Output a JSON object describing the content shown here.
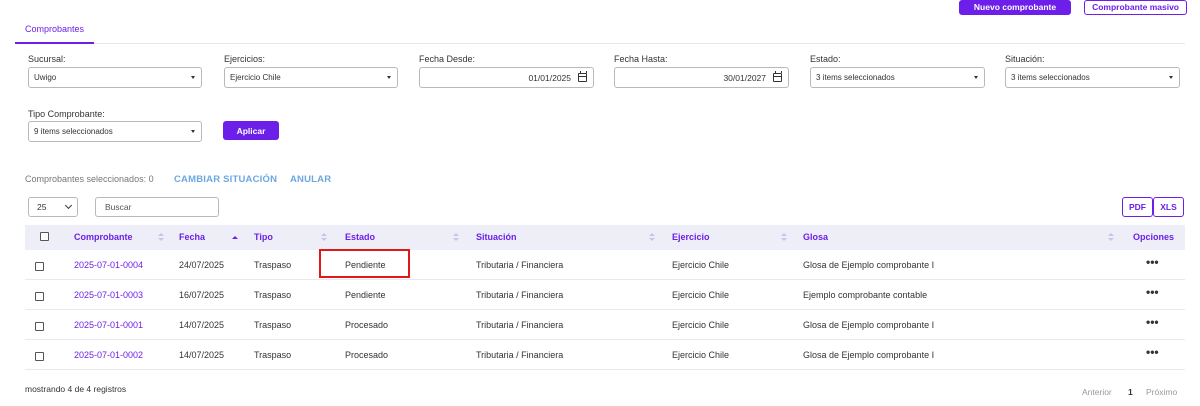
{
  "header": {
    "new_button": "Nuevo comprobante",
    "bulk_button": "Comprobante masivo"
  },
  "tabs": [
    {
      "label": "Comprobantes"
    }
  ],
  "filters": {
    "sucursal": {
      "label": "Sucursal:",
      "value": "Uwigo"
    },
    "ejercicios": {
      "label": "Ejercicios:",
      "value": "Ejercicio Chile"
    },
    "fecha_desde": {
      "label": "Fecha Desde:",
      "value": "01/01/2025"
    },
    "fecha_hasta": {
      "label": "Fecha Hasta:",
      "value": "30/01/2027"
    },
    "estado": {
      "label": "Estado:",
      "value": "3 items seleccionados"
    },
    "situacion": {
      "label": "Situación:",
      "value": "3 items seleccionados"
    },
    "tipo": {
      "label": "Tipo Comprobante:",
      "value": "9 items seleccionados"
    },
    "apply_button": "Aplicar"
  },
  "selection": {
    "text": "Comprobantes seleccionados: 0",
    "change_status": "CAMBIAR SITUACIÓN",
    "cancel": "ANULAR"
  },
  "toolbar": {
    "page_size": "25",
    "search_placeholder": "Buscar",
    "pdf": "PDF",
    "xls": "XLS"
  },
  "table": {
    "columns": [
      "Comprobante",
      "Fecha",
      "Tipo",
      "Estado",
      "Situación",
      "Ejercicio",
      "Glosa",
      "Opciones"
    ],
    "rows": [
      {
        "comprobante": "2025-07-01-0004",
        "fecha": "24/07/2025",
        "tipo": "Traspaso",
        "estado": "Pendiente",
        "situacion": "Tributaria / Financiera",
        "ejercicio": "Ejercicio Chile",
        "glosa": "Glosa de Ejemplo comprobante I"
      },
      {
        "comprobante": "2025-07-01-0003",
        "fecha": "16/07/2025",
        "tipo": "Traspaso",
        "estado": "Pendiente",
        "situacion": "Tributaria / Financiera",
        "ejercicio": "Ejercicio Chile",
        "glosa": "Ejemplo comprobante contable"
      },
      {
        "comprobante": "2025-07-01-0001",
        "fecha": "14/07/2025",
        "tipo": "Traspaso",
        "estado": "Procesado",
        "situacion": "Tributaria / Financiera",
        "ejercicio": "Ejercicio Chile",
        "glosa": "Glosa de Ejemplo comprobante I"
      },
      {
        "comprobante": "2025-07-01-0002",
        "fecha": "14/07/2025",
        "tipo": "Traspaso",
        "estado": "Procesado",
        "situacion": "Tributaria / Financiera",
        "ejercicio": "Ejercicio Chile",
        "glosa": "Glosa de Ejemplo comprobante I"
      }
    ],
    "options_icon": "more-horizontal-icon"
  },
  "footer": {
    "summary": "mostrando 4 de 4 registros",
    "prev": "Anterior",
    "page": "1",
    "next": "Próximo"
  },
  "colors": {
    "accent": "#6c1fe8",
    "header_bg": "#eeeef8",
    "link_action": "#6ba8e0",
    "highlight": "#e01818"
  }
}
